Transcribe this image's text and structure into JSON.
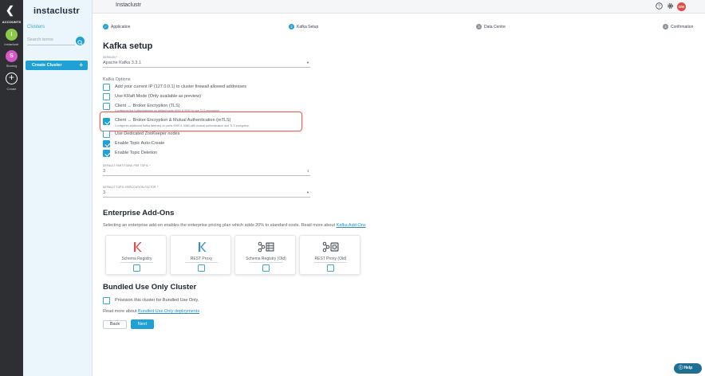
{
  "rail": {
    "accounts_label": "ACCOUNTS",
    "instaclustr_avatar": "I",
    "instaclustr_caption": "Instaclustr",
    "sharing_avatar": "S",
    "sharing_caption": "Sharing",
    "create_caption": "Create"
  },
  "sidebar": {
    "logo": "instaclustr",
    "title": "Clusters",
    "search_placeholder": "Search terms",
    "create_cluster": "Create Cluster"
  },
  "topbar": {
    "brand": "Instaclustr",
    "user_initials": "GW"
  },
  "stepper": [
    {
      "label": "Application",
      "marker": "✓",
      "state": "done"
    },
    {
      "label": "Kafka Setup",
      "marker": "2",
      "state": "active"
    },
    {
      "label": "Data Centre",
      "marker": "3",
      "state": "todo"
    },
    {
      "label": "Confirmation",
      "marker": "4",
      "state": "todo"
    }
  ],
  "kafka": {
    "title": "Kafka setup",
    "version_label": "VERSION *",
    "version_value": "Apache Kafka 3.3.1",
    "options_label": "Kafka Options",
    "options": [
      {
        "label": "Add your current IP (127.0.0.1) to cluster firewall allowed addresses",
        "checked": false
      },
      {
        "label": "Use KRaft Mode (Only available as preview)",
        "checked": false
      },
      {
        "label": "Client ↔ Broker Encryption (TLS)",
        "checked": false,
        "sub": "Configures the Kafka listeners on default ports 9093 & 9092 to use TLS encryption"
      },
      {
        "label": "Client ↔ Broker Encryption & Mutual Authentication (mTLS)",
        "checked": true,
        "sub": "Configures additional Kafka listeners on ports 9090 & 9080 with mutual authentication and TLS encryption"
      },
      {
        "label": "Use Dedicated ZooKeeper nodes",
        "checked": false
      },
      {
        "label": "Enable Topic Auto-Create",
        "checked": true
      },
      {
        "label": "Enable Topic Deletion",
        "checked": true
      }
    ],
    "partitions_label": "DEFAULT PARTITIONS PER TOPIC *",
    "partitions_value": "3",
    "replication_label": "DEFAULT TOPIC REPLICATION FACTOR *",
    "replication_value": "3"
  },
  "addons": {
    "title": "Enterprise Add-Ons",
    "desc": "Selecting an enterprise add-on enables the enterprise pricing plan which adds 20% to standard costs. Read more about",
    "link": "Kafka Add-Ons",
    "cards": [
      {
        "label": "Schema Registry",
        "icon": "kafka-k-red-icon"
      },
      {
        "label": "REST Proxy",
        "icon": "kafka-k-blue-icon"
      },
      {
        "label": "Schema Registry (Old)",
        "icon": "kafka-cluster-grid-icon"
      },
      {
        "label": "REST Proxy (Old)",
        "icon": "kafka-cluster-gear-icon"
      }
    ]
  },
  "bundled": {
    "title": "Bundled Use Only Cluster",
    "option": "Provision this cluster for Bundled Use Only.",
    "read_more": "Read more about",
    "link": "Bundled Use Only deployments"
  },
  "actions": {
    "back": "Back",
    "next": "Next",
    "help": "Help"
  }
}
